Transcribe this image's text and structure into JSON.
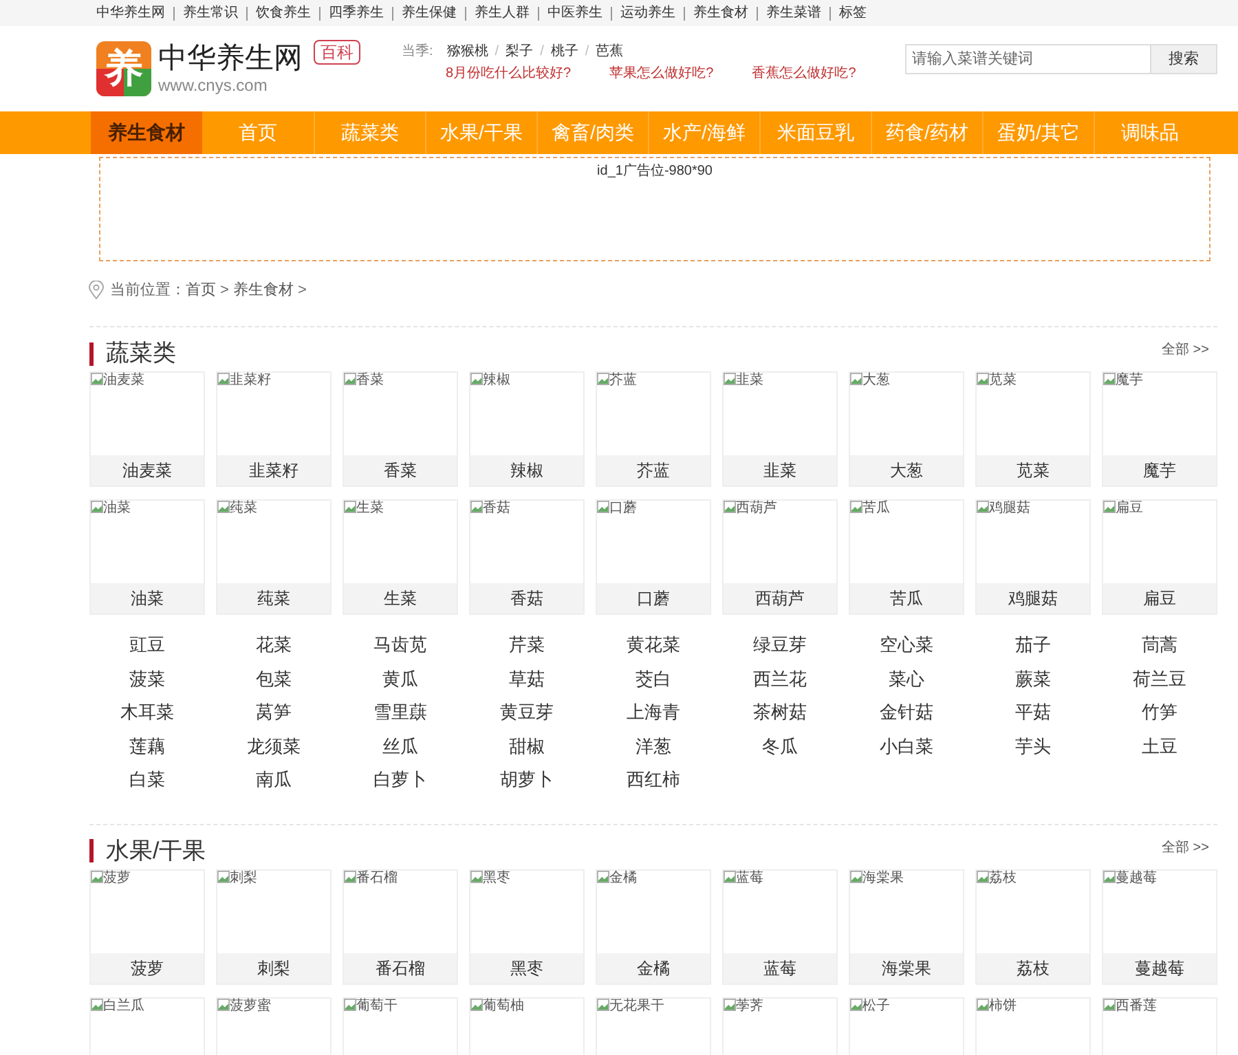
{
  "top_links": [
    "中华养生网",
    "养生常识",
    "饮食养生",
    "四季养生",
    "养生保健",
    "养生人群",
    "中医养生",
    "运动养生",
    "养生食材",
    "养生菜谱",
    "标签"
  ],
  "header": {
    "logo_mark": "养",
    "site_name": "中华养生网",
    "domain": "www.cnys.com",
    "badge": "百科",
    "season_label": "当季:",
    "season_items": [
      "猕猴桃",
      "梨子",
      "桃子",
      "芭蕉"
    ],
    "season_separator": "/",
    "questions": [
      "8月份吃什么比较好?",
      "苹果怎么做好吃?",
      "香蕉怎么做好吃?"
    ],
    "search": {
      "placeholder": "请输入菜谱关键词",
      "button": "搜索"
    }
  },
  "nav": [
    {
      "label": "养生食材",
      "selected": true
    },
    {
      "label": "首页",
      "selected": false
    },
    {
      "label": "蔬菜类",
      "selected": false
    },
    {
      "label": "水果/干果",
      "selected": false
    },
    {
      "label": "禽畜/肉类",
      "selected": false
    },
    {
      "label": "水产/海鲜",
      "selected": false
    },
    {
      "label": "米面豆乳",
      "selected": false
    },
    {
      "label": "药食/药材",
      "selected": false
    },
    {
      "label": "蛋奶/其它",
      "selected": false
    },
    {
      "label": "调味品",
      "selected": false
    }
  ],
  "ad": {
    "text": "id_1广告位-980*90"
  },
  "breadcrumb": {
    "label": "当前位置：",
    "items": [
      "首页",
      "养生食材"
    ],
    "separator": ">"
  },
  "sections": [
    {
      "title": "蔬菜类",
      "more": "全部 >>",
      "tiles": [
        {
          "image_alt": "油麦菜",
          "label": "油麦菜"
        },
        {
          "image_alt": "韭菜籽",
          "label": "韭菜籽"
        },
        {
          "image_alt": "香菜",
          "label": "香菜"
        },
        {
          "image_alt": "辣椒",
          "label": "辣椒"
        },
        {
          "image_alt": "芥蓝",
          "label": "芥蓝"
        },
        {
          "image_alt": "韭菜",
          "label": "韭菜"
        },
        {
          "image_alt": "大葱",
          "label": "大葱"
        },
        {
          "image_alt": "苋菜",
          "label": "苋菜"
        },
        {
          "image_alt": "魔芋",
          "label": "魔芋"
        },
        {
          "image_alt": "油菜",
          "label": "油菜"
        },
        {
          "image_alt": "莼菜",
          "label": "莼菜"
        },
        {
          "image_alt": "生菜",
          "label": "生菜"
        },
        {
          "image_alt": "香菇",
          "label": "香菇"
        },
        {
          "image_alt": "口蘑",
          "label": "口蘑"
        },
        {
          "image_alt": "西葫芦",
          "label": "西葫芦"
        },
        {
          "image_alt": "苦瓜",
          "label": "苦瓜"
        },
        {
          "image_alt": "鸡腿菇",
          "label": "鸡腿菇"
        },
        {
          "image_alt": "扁豆",
          "label": "扁豆"
        }
      ],
      "links": [
        "豇豆",
        "花菜",
        "马齿苋",
        "芹菜",
        "黄花菜",
        "绿豆芽",
        "空心菜",
        "茄子",
        "茼蒿",
        "菠菜",
        "包菜",
        "黄瓜",
        "草菇",
        "茭白",
        "西兰花",
        "菜心",
        "蕨菜",
        "荷兰豆",
        "木耳菜",
        "莴笋",
        "雪里蕻",
        "黄豆芽",
        "上海青",
        "茶树菇",
        "金针菇",
        "平菇",
        "竹笋",
        "莲藕",
        "龙须菜",
        "丝瓜",
        "甜椒",
        "洋葱",
        "冬瓜",
        "小白菜",
        "芋头",
        "土豆",
        "白菜",
        "南瓜",
        "白萝卜",
        "胡萝卜",
        "西红柿"
      ]
    },
    {
      "title": "水果/干果",
      "more": "全部 >>",
      "tiles": [
        {
          "image_alt": "菠萝",
          "label": "菠萝"
        },
        {
          "image_alt": "刺梨",
          "label": "刺梨"
        },
        {
          "image_alt": "番石榴",
          "label": "番石榴"
        },
        {
          "image_alt": "黑枣",
          "label": "黑枣"
        },
        {
          "image_alt": "金橘",
          "label": "金橘"
        },
        {
          "image_alt": "蓝莓",
          "label": "蓝莓"
        },
        {
          "image_alt": "海棠果",
          "label": "海棠果"
        },
        {
          "image_alt": "荔枝",
          "label": "荔枝"
        },
        {
          "image_alt": "蔓越莓",
          "label": "蔓越莓"
        },
        {
          "image_alt": "白兰瓜"
        },
        {
          "image_alt": "菠萝蜜"
        },
        {
          "image_alt": "葡萄干"
        },
        {
          "image_alt": "葡萄柚"
        },
        {
          "image_alt": "无花果干"
        },
        {
          "image_alt": "荸荠"
        },
        {
          "image_alt": "松子"
        },
        {
          "image_alt": "柿饼"
        },
        {
          "image_alt": "西番莲"
        }
      ]
    }
  ]
}
